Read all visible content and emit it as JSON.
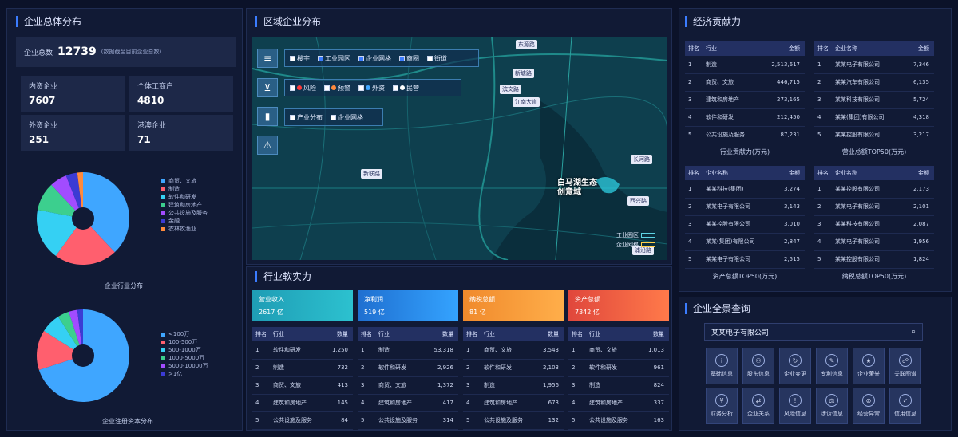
{
  "colors": {
    "bg": "#0b1229",
    "panel": "#111a35",
    "accent": "#3b7cff"
  },
  "left": {
    "title": "企业总体分布",
    "total_label": "企业总数",
    "total_value": "12739",
    "total_note": "(数据截至目前企业总数)",
    "stats": [
      {
        "label": "内资企业",
        "value": "7607"
      },
      {
        "label": "个体工商户",
        "value": "4810"
      },
      {
        "label": "外资企业",
        "value": "251"
      },
      {
        "label": "港澳企业",
        "value": "71"
      }
    ],
    "industry_legend": [
      {
        "label": "商贸、文旅",
        "color": "#3fa6ff"
      },
      {
        "label": "制造",
        "color": "#ff5f6e"
      },
      {
        "label": "软件和研发",
        "color": "#35d0f3"
      },
      {
        "label": "建筑和房地产",
        "color": "#3ccf8e"
      },
      {
        "label": "公共设施及服务",
        "color": "#a24cff"
      },
      {
        "label": "金融",
        "color": "#3b3bd4"
      },
      {
        "label": "农林牧渔业",
        "color": "#ff8a3c"
      }
    ],
    "industry_caption": "企业行业分布",
    "capital_legend": [
      {
        "label": "<100万",
        "color": "#3fa6ff"
      },
      {
        "label": "100-500万",
        "color": "#ff5f6e"
      },
      {
        "label": "500-1000万",
        "color": "#35d0f3"
      },
      {
        "label": "1000-5000万",
        "color": "#3ccf8e"
      },
      {
        "label": "5000-10000万",
        "color": "#a24cff"
      },
      {
        "label": ">1亿",
        "color": "#3b3bd4"
      }
    ],
    "capital_caption": "企业注册资本分布"
  },
  "chart_data": [
    {
      "type": "pie",
      "title": "企业行业分布",
      "categories": [
        "商贸、文旅",
        "制造",
        "软件和研发",
        "建筑和房地产",
        "公共设施及服务",
        "金融",
        "农林牧渔业"
      ],
      "values": [
        38,
        22,
        18,
        10,
        6,
        4,
        2
      ]
    },
    {
      "type": "pie",
      "title": "企业注册资本分布",
      "categories": [
        "<100万",
        "100-500万",
        "500-1000万",
        "1000-5000万",
        "5000-10000万",
        ">1亿"
      ],
      "values": [
        70,
        14,
        7,
        4,
        3,
        2
      ]
    }
  ],
  "map": {
    "title": "区域企业分布",
    "row1": [
      {
        "label": "楼宇",
        "checked": false
      },
      {
        "label": "工业园区",
        "checked": true
      },
      {
        "label": "企业网格",
        "checked": true
      },
      {
        "label": "商圈",
        "checked": true
      },
      {
        "label": "街道",
        "checked": false
      }
    ],
    "row2": [
      {
        "label": "风险",
        "color": "#ff3b3b"
      },
      {
        "label": "预警",
        "color": "#ff8a3c"
      },
      {
        "label": "外资",
        "color": "#3fa6ff"
      },
      {
        "label": "民营",
        "color": "#ffffff"
      }
    ],
    "row3": [
      "产业分布",
      "企业网格"
    ],
    "tool_icons": [
      "layers-icon",
      "filter-icon",
      "chart-icon",
      "warning-icon"
    ],
    "zone_label": "白马湖生态\n创意城",
    "place_labels": [
      "东源路",
      "新塘路",
      "滨文路",
      "江南大道",
      "新联路",
      "长河路",
      "西兴路",
      "浦沿路"
    ],
    "legend": [
      "工业园区",
      "企业网格"
    ]
  },
  "industry": {
    "title": "行业软实力",
    "cards": [
      {
        "title": "营业收入",
        "value": "2617 亿",
        "color1": "#1f9db5",
        "color2": "#2cc1cf"
      },
      {
        "title": "净利润",
        "value": "519 亿",
        "color1": "#1f6fd0",
        "color2": "#34a3ff"
      },
      {
        "title": "纳税总额",
        "value": "81 亿",
        "color1": "#f08a2c",
        "color2": "#ffae4a"
      },
      {
        "title": "资产总额",
        "value": "7342 亿",
        "color1": "#e0473c",
        "color2": "#ff7a4a"
      }
    ],
    "tables": [
      {
        "headers": [
          "排名",
          "行业",
          "数量"
        ],
        "rows": [
          [
            "1",
            "软件和研发",
            "1,250"
          ],
          [
            "2",
            "制造",
            "732"
          ],
          [
            "3",
            "商贸、文旅",
            "413"
          ],
          [
            "4",
            "建筑和房地产",
            "145"
          ],
          [
            "5",
            "公共设施及服务",
            "84"
          ]
        ]
      },
      {
        "headers": [
          "排名",
          "行业",
          "数量"
        ],
        "rows": [
          [
            "1",
            "制造",
            "53,318"
          ],
          [
            "2",
            "软件和研发",
            "2,926"
          ],
          [
            "3",
            "商贸、文旅",
            "1,372"
          ],
          [
            "4",
            "建筑和房地产",
            "417"
          ],
          [
            "5",
            "公共设施及服务",
            "314"
          ]
        ]
      },
      {
        "headers": [
          "排名",
          "行业",
          "数量"
        ],
        "rows": [
          [
            "1",
            "商贸、文旅",
            "3,543"
          ],
          [
            "2",
            "软件和研发",
            "2,103"
          ],
          [
            "3",
            "制造",
            "1,956"
          ],
          [
            "4",
            "建筑和房地产",
            "673"
          ],
          [
            "5",
            "公共设施及服务",
            "132"
          ]
        ]
      },
      {
        "headers": [
          "排名",
          "行业",
          "数量"
        ],
        "rows": [
          [
            "1",
            "商贸、文旅",
            "1,013"
          ],
          [
            "2",
            "软件和研发",
            "961"
          ],
          [
            "3",
            "制造",
            "824"
          ],
          [
            "4",
            "建筑和房地产",
            "337"
          ],
          [
            "5",
            "公共设施及服务",
            "163"
          ]
        ]
      }
    ]
  },
  "economy": {
    "title": "经济贡献力",
    "tables": [
      {
        "headers": [
          "排名",
          "行业",
          "金额"
        ],
        "rows": [
          [
            "1",
            "制造",
            "2,513,617"
          ],
          [
            "2",
            "商贸、文旅",
            "446,715"
          ],
          [
            "3",
            "建筑和房地产",
            "273,165"
          ],
          [
            "4",
            "软件和研发",
            "212,450"
          ],
          [
            "5",
            "公共设施及服务",
            "87,231"
          ]
        ],
        "caption": "行业贡献力(万元)"
      },
      {
        "headers": [
          "排名",
          "企业名称",
          "金额"
        ],
        "rows": [
          [
            "1",
            "某某电子有限公司",
            "7,346"
          ],
          [
            "2",
            "某某汽车有限公司",
            "6,135"
          ],
          [
            "3",
            "某某科技有限公司",
            "5,724"
          ],
          [
            "4",
            "某某(集团)有限公司",
            "4,318"
          ],
          [
            "5",
            "某某控股有限公司",
            "3,217"
          ]
        ],
        "caption": "营业总额TOP50(万元)"
      },
      {
        "headers": [
          "排名",
          "企业名称",
          "金额"
        ],
        "rows": [
          [
            "1",
            "某某科技(集团)",
            "3,274"
          ],
          [
            "2",
            "某某电子有限公司",
            "3,143"
          ],
          [
            "3",
            "某某控股有限公司",
            "3,010"
          ],
          [
            "4",
            "某某(集团)有限公司",
            "2,847"
          ],
          [
            "5",
            "某某电子有限公司",
            "2,515"
          ]
        ],
        "caption": "资产总额TOP50(万元)"
      },
      {
        "headers": [
          "排名",
          "企业名称",
          "金额"
        ],
        "rows": [
          [
            "1",
            "某某控股有限公司",
            "2,173"
          ],
          [
            "2",
            "某某电子有限公司",
            "2,101"
          ],
          [
            "3",
            "某某科技有限公司",
            "2,087"
          ],
          [
            "4",
            "某某电子有限公司",
            "1,956"
          ],
          [
            "5",
            "某某控股有限公司",
            "1,824"
          ]
        ],
        "caption": "纳税总额TOP50(万元)"
      }
    ]
  },
  "query": {
    "title": "企业全景查询",
    "search_value": "某某电子有限公司",
    "buttons": [
      {
        "label": "基础信息",
        "icon": "info-icon"
      },
      {
        "label": "股东信息",
        "icon": "users-icon"
      },
      {
        "label": "企业变更",
        "icon": "change-icon"
      },
      {
        "label": "专利信息",
        "icon": "patent-icon"
      },
      {
        "label": "企业荣誉",
        "icon": "award-icon"
      },
      {
        "label": "关联图谱",
        "icon": "graph-icon"
      },
      {
        "label": "财务分析",
        "icon": "finance-icon"
      },
      {
        "label": "企业关系",
        "icon": "relation-icon"
      },
      {
        "label": "风险信息",
        "icon": "risk-icon"
      },
      {
        "label": "涉诉信息",
        "icon": "lawsuit-icon"
      },
      {
        "label": "经营异常",
        "icon": "abnormal-icon"
      },
      {
        "label": "信用信息",
        "icon": "credit-icon"
      }
    ]
  }
}
